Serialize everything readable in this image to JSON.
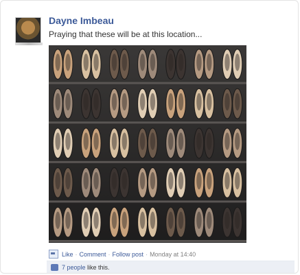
{
  "post": {
    "author": "Dayne Imbeau",
    "status_text": "Praying that these will be at this location...",
    "photo": {
      "subject": "wall of patterned slip-on shoes"
    }
  },
  "actions": {
    "like": "Like",
    "comment": "Comment",
    "follow": "Follow post",
    "timestamp": "Monday at 14:40",
    "separator": "·"
  },
  "likes": {
    "count_text": "7 people",
    "suffix": " like this."
  },
  "colors": {
    "name": "#3b5998",
    "likes_bar": "#eceff5"
  }
}
